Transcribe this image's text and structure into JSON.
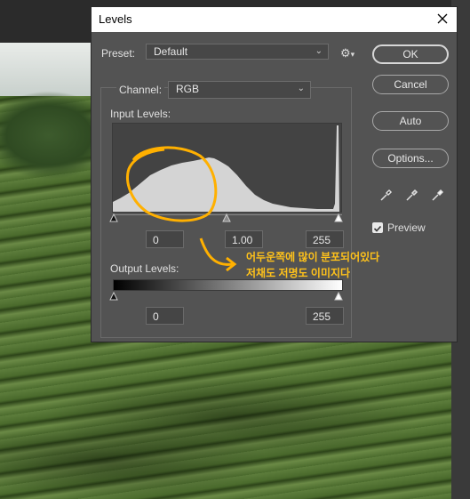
{
  "dialog": {
    "title": "Levels",
    "preset_label": "Preset:",
    "preset_value": "Default",
    "channel_label": "Channel:",
    "channel_value": "RGB",
    "input_levels_label": "Input Levels:",
    "input_black": "0",
    "input_gamma": "1.00",
    "input_white": "255",
    "output_levels_label": "Output Levels:",
    "output_black": "0",
    "output_white": "255",
    "buttons": {
      "ok": "OK",
      "cancel": "Cancel",
      "auto": "Auto",
      "options": "Options..."
    },
    "preview_label": "Preview",
    "preview_checked": true
  },
  "annotation": {
    "line1": "어두운쪽에 많이 분포되어있다",
    "line2": "저채도 저명도 이미지다",
    "color": "#ffb000"
  },
  "icons": {
    "close": "close-icon",
    "gear": "gear-icon",
    "eyedroppers": [
      "black-point-eyedropper-icon",
      "gray-point-eyedropper-icon",
      "white-point-eyedropper-icon"
    ]
  }
}
